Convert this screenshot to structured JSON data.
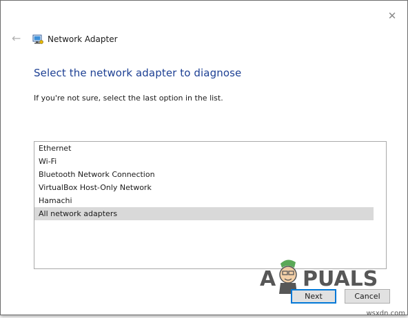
{
  "window": {
    "close_glyph": "✕",
    "back_glyph": "←",
    "title": "Network Adapter"
  },
  "content": {
    "heading": "Select the network adapter to diagnose",
    "instruction": "If you're not sure, select the last option in the list."
  },
  "adapters": {
    "items": [
      {
        "label": "Ethernet",
        "selected": false
      },
      {
        "label": "Wi-Fi",
        "selected": false
      },
      {
        "label": "Bluetooth Network Connection",
        "selected": false
      },
      {
        "label": "VirtualBox Host-Only Network",
        "selected": false
      },
      {
        "label": "Hamachi",
        "selected": false
      },
      {
        "label": "All network adapters",
        "selected": true
      }
    ]
  },
  "buttons": {
    "next_label": "Next",
    "cancel_label": "Cancel"
  },
  "watermark": {
    "logo_text": "APPUALS",
    "domain": "wsxdn.com"
  },
  "colors": {
    "heading": "#1c3f93",
    "selection": "#d9d9d9",
    "focus_border": "#0078d7"
  },
  "icons": {
    "close": "close-icon",
    "back": "back-arrow-icon",
    "title": "network-adapter-icon"
  }
}
